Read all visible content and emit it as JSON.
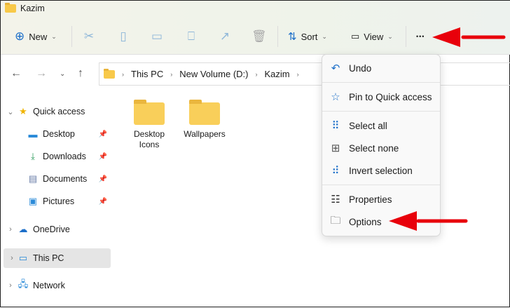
{
  "window": {
    "title": "Kazim"
  },
  "toolbar": {
    "new_label": "New",
    "sort_label": "Sort",
    "view_label": "View",
    "more_label": "•••"
  },
  "address": {
    "crumbs": [
      "This PC",
      "New Volume (D:)",
      "Kazim"
    ]
  },
  "sidebar": {
    "items": [
      {
        "label": "Quick access",
        "icon": "star-icon"
      },
      {
        "label": "Desktop",
        "icon": "desktop-icon"
      },
      {
        "label": "Downloads",
        "icon": "download-icon"
      },
      {
        "label": "Documents",
        "icon": "document-icon"
      },
      {
        "label": "Pictures",
        "icon": "pictures-icon"
      },
      {
        "label": "OneDrive",
        "icon": "cloud-icon"
      },
      {
        "label": "This PC",
        "icon": "computer-icon"
      },
      {
        "label": "Network",
        "icon": "network-icon"
      }
    ]
  },
  "files": [
    {
      "label": "Desktop Icons"
    },
    {
      "label": "Wallpapers"
    }
  ],
  "menu": {
    "items": [
      {
        "label": "Undo"
      },
      {
        "label": "Pin to Quick access"
      },
      {
        "label": "Select all"
      },
      {
        "label": "Select none"
      },
      {
        "label": "Invert selection"
      },
      {
        "label": "Properties"
      },
      {
        "label": "Options"
      }
    ]
  },
  "colors": {
    "accent": "#1d6fc9",
    "arrow": "#e8000b",
    "selected": "#e5e5e5"
  }
}
